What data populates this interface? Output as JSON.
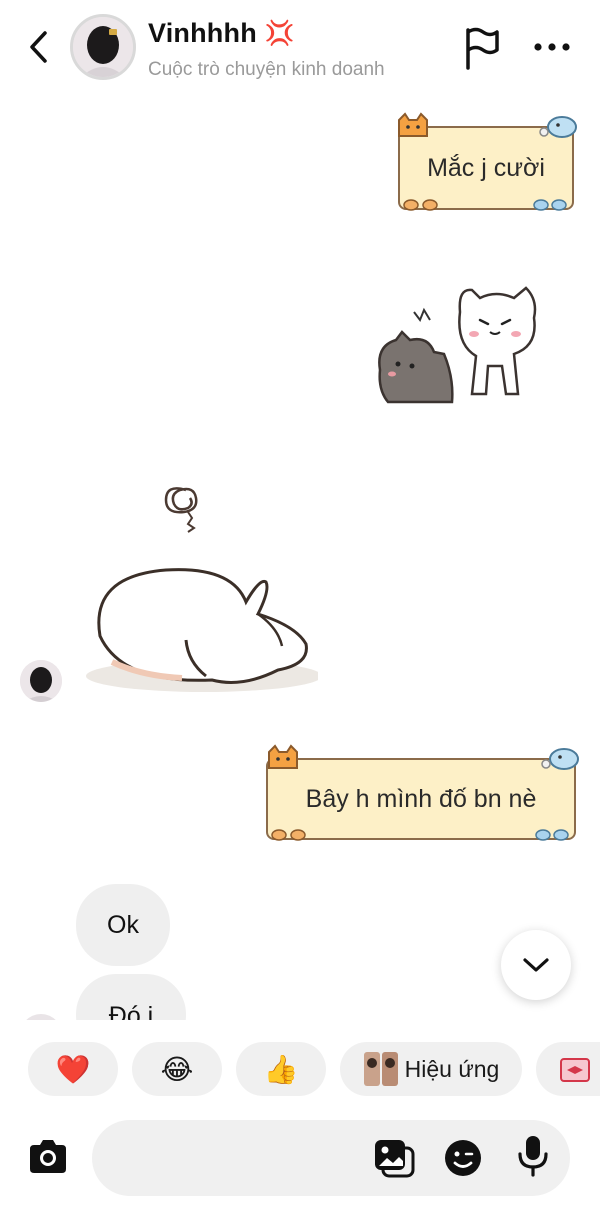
{
  "header": {
    "contact_name": "Vinhhhh",
    "name_emoji": "💢",
    "subtitle": "Cuộc trò chuyện kinh doanh"
  },
  "messages": {
    "note1_text": "Mắc j cười",
    "note2_text": "Bây h mình đố bn nè",
    "reply1": "Ok",
    "reply2_partial": "Đó j"
  },
  "reactions": {
    "heart": "❤️",
    "laugh": "😂",
    "thumbs": "👍",
    "effects_label": "Hiệu ứng"
  },
  "icons": {
    "back": "chevron-left-icon",
    "flag": "flag-icon",
    "more": "more-horizontal-icon",
    "scroll": "chevron-down-icon",
    "camera": "camera-icon",
    "gallery": "gallery-icon",
    "sticker": "sticker-icon",
    "mic": "microphone-icon"
  },
  "colors": {
    "note_bg": "#fdf0c7",
    "note_border": "#8b6b4a",
    "bubble_bg": "#efefef",
    "chip_bg": "#f0f0f0"
  }
}
